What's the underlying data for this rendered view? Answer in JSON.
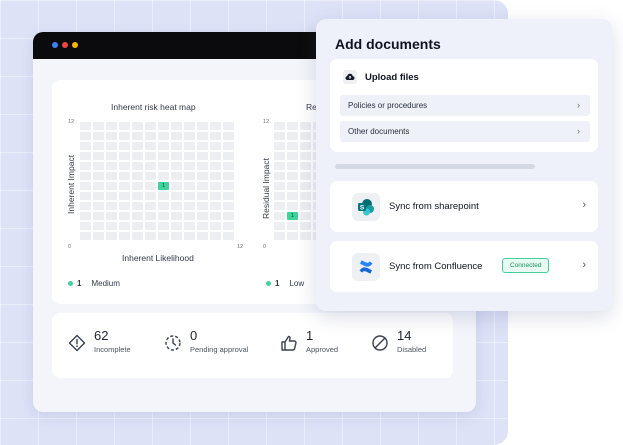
{
  "heatmaps": [
    {
      "title": "Inherent risk heat map",
      "ylabel": "Inherent Impact",
      "xlabel": "Inherent Likelihood",
      "y_top_tick": "12",
      "origin_tick": "0",
      "x_end_tick": "12",
      "cell_value": "1",
      "legend_count": "1",
      "legend_label": "Medium",
      "accent": "#3dd39a"
    },
    {
      "title": "Re",
      "ylabel": "Residual Impact",
      "y_top_tick": "12",
      "origin_tick": "0",
      "cell_value": "1",
      "legend_count": "1",
      "legend_label": "Low",
      "accent": "#3dd39a"
    }
  ],
  "stats": [
    {
      "value": "62",
      "label": "Incomplete",
      "icon": "alert-diamond-icon"
    },
    {
      "value": "0",
      "label": "Pending approval",
      "icon": "pending-clock-icon"
    },
    {
      "value": "1",
      "label": "Approved",
      "icon": "thumbs-up-icon"
    },
    {
      "value": "14",
      "label": "Disabled",
      "icon": "disabled-circle-icon"
    }
  ],
  "add_documents": {
    "title": "Add documents",
    "upload_label": "Upload files",
    "rows": [
      {
        "label": "Policies or procedures"
      },
      {
        "label": "Other documents"
      }
    ],
    "sync": [
      {
        "label": "Sync from sharepoint",
        "icon": "sharepoint-icon"
      },
      {
        "label": "Sync from Confluence",
        "icon": "confluence-icon",
        "badge": "Connected"
      }
    ]
  },
  "colors": {
    "background": "#dde2f7",
    "titlebar": "#0b0b0d",
    "accent_green": "#3dd39a"
  }
}
